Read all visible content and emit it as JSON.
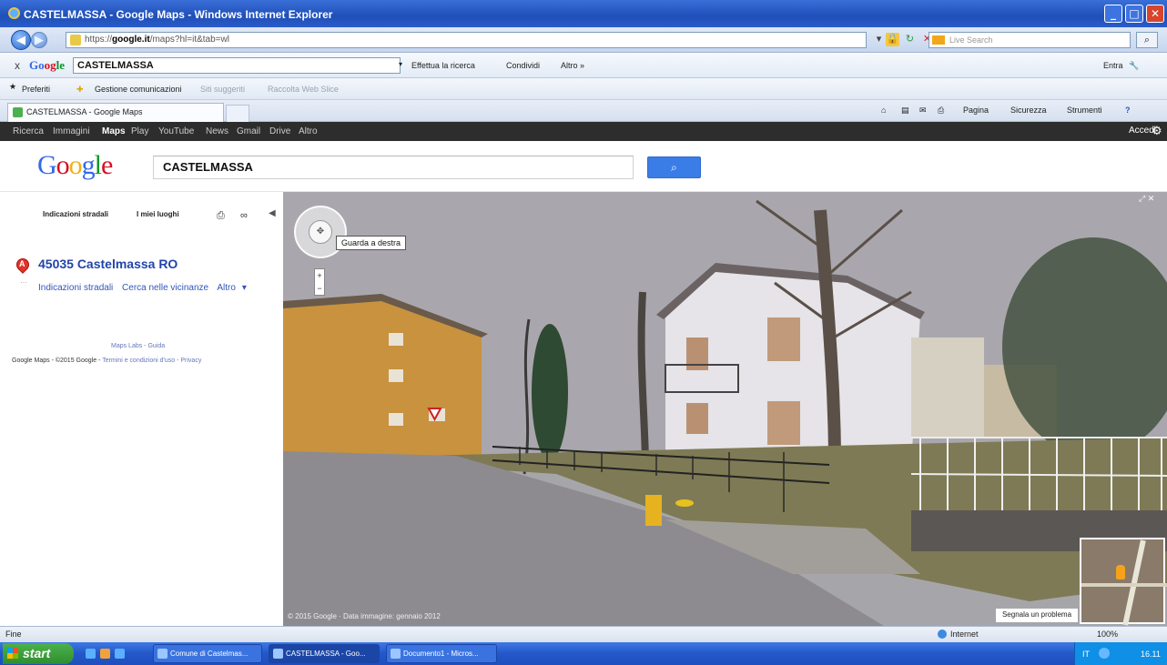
{
  "window": {
    "title": "CASTELMASSA - Google Maps - Windows Internet Explorer",
    "url_scheme": "https://",
    "url_domain": "google.it",
    "url_path": "maps?hl=it&tab=wl",
    "live_search_placeholder": "Live Search",
    "min": "_",
    "max": "□",
    "close": "✕"
  },
  "google_toolbar": {
    "close": "x",
    "logo": "Google",
    "search_value": "CASTELMASSA",
    "search_btn": "Effettua la ricerca",
    "share_btn": "Condividi",
    "more": "Altro »",
    "enter": "Entra"
  },
  "favorites_bar": {
    "favorites": "Preferiti",
    "item1": "Gestione comunicazioni",
    "item2": "Siti suggeriti",
    "item3": "Raccolta Web Slice"
  },
  "tabs": {
    "active": "CASTELMASSA - Google Maps"
  },
  "command_bar": {
    "page": "Pagina",
    "security": "Sicurezza",
    "tools": "Strumenti"
  },
  "google_nav": {
    "items": [
      "Ricerca",
      "Immagini",
      "Maps",
      "Play",
      "YouTube",
      "News",
      "Gmail",
      "Drive",
      "Altro"
    ],
    "active": "Maps",
    "login": "Accedi"
  },
  "maps_header": {
    "logo_letters": [
      "G",
      "o",
      "o",
      "g",
      "l",
      "e"
    ],
    "logo_colors": [
      "#3369e8",
      "#d50f25",
      "#eeb211",
      "#3369e8",
      "#009925",
      "#d50f25"
    ],
    "search_value": "CASTELMASSA",
    "search_btn_icon": "search-icon"
  },
  "left_panel": {
    "directions_btn": "Indicazioni stradali",
    "my_places_btn": "I miei luoghi",
    "marker_label": "A",
    "place_name": "45035 Castelmassa RO",
    "link_directions": "Indicazioni stradali",
    "link_nearby": "Cerca nelle vicinanze",
    "link_more": "Altro",
    "footer_labs": "Maps Labs - Guida",
    "footer_copyright": "Google Maps - ©2015 Google -",
    "footer_terms": "Termini e condizioni d'uso - Privacy"
  },
  "street_view": {
    "tooltip": "Guarda a destra",
    "zoom_in": "+",
    "zoom_out": "−",
    "copyright": "© 2015 Google · Data immagine: gennaio 2012",
    "report": "Segnala un problema"
  },
  "status_bar": {
    "status": "Fine",
    "zone": "Internet",
    "zoom": "100%"
  },
  "taskbar": {
    "start": "start",
    "tasks": [
      "Comune di Castelmas...",
      "CASTELMASSA - Goo...",
      "Documento1 - Micros..."
    ],
    "active_task": 1,
    "lang": "IT",
    "time": "16.11"
  }
}
